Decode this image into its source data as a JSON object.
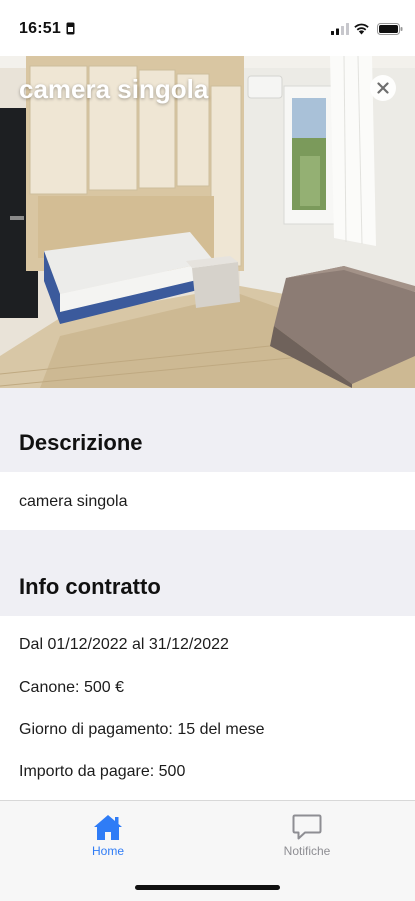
{
  "status_bar": {
    "time": "16:51"
  },
  "hero": {
    "title": "camera singola",
    "close_icon": "close-icon"
  },
  "descrizione": {
    "heading": "Descrizione",
    "text": "camera singola"
  },
  "info_contratto": {
    "heading": "Info contratto",
    "lines": [
      "Dal 01/12/2022 al 31/12/2022",
      "Canone: 500 €",
      "Giorno di pagamento: 15 del mese",
      "Importo da pagare: 500"
    ]
  },
  "tab_bar": {
    "tabs": [
      {
        "label": "Home",
        "icon": "home-icon",
        "active": true
      },
      {
        "label": "Notifiche",
        "icon": "chat-bubble-icon",
        "active": false
      }
    ]
  },
  "colors": {
    "accent": "#2f7cf6",
    "inactive": "#8e8e93"
  }
}
